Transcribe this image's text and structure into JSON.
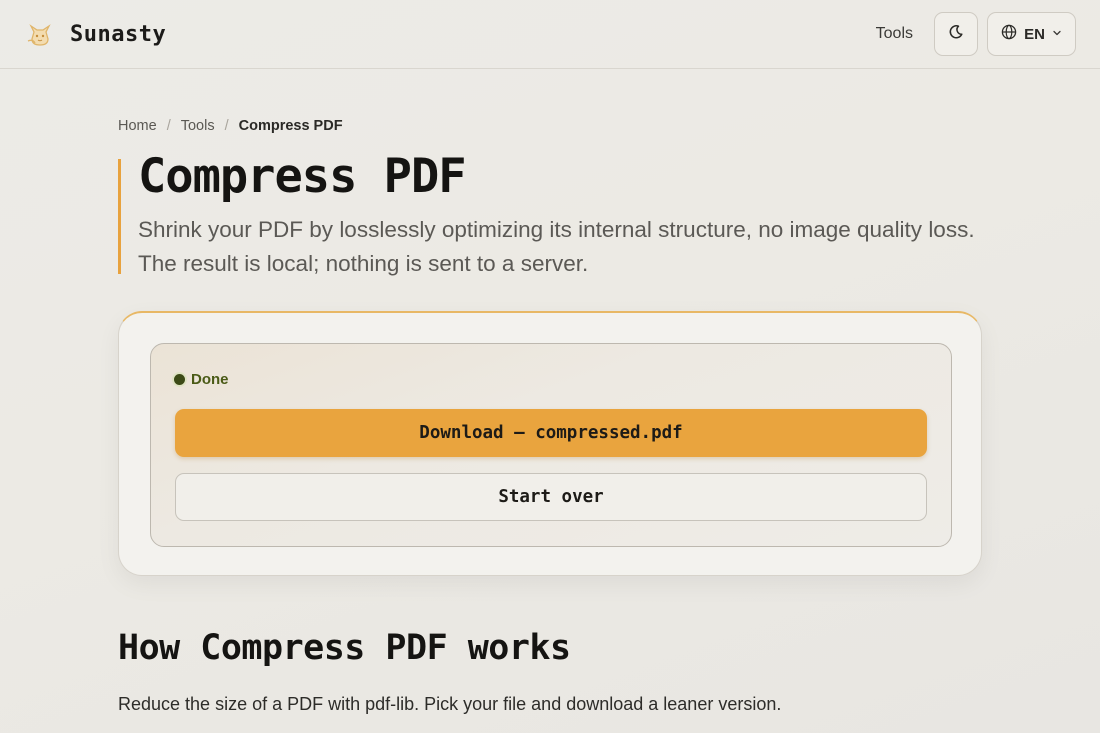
{
  "header": {
    "brand": "Sunasty",
    "logo_icon": "cat-icon",
    "nav_tools": "Tools",
    "theme_icon": "moon-icon",
    "language": "EN",
    "language_icon": "globe-icon",
    "language_chevron": "chevron-down-icon"
  },
  "breadcrumb": {
    "home": "Home",
    "tools": "Tools",
    "current": "Compress PDF",
    "separator": "/"
  },
  "hero": {
    "title": "Compress PDF",
    "subtitle": "Shrink your PDF by losslessly optimizing its internal structure, no image quality loss. The result is local; nothing is sent to a server."
  },
  "result": {
    "status": "Done",
    "download_label": "Download — compressed.pdf",
    "start_over_label": "Start over"
  },
  "how": {
    "title": "How Compress PDF works",
    "description": "Reduce the size of a PDF with pdf-lib. Pick your file and download a leaner version."
  },
  "colors": {
    "accent": "#e9a43e",
    "status_done": "#4a5a16"
  }
}
